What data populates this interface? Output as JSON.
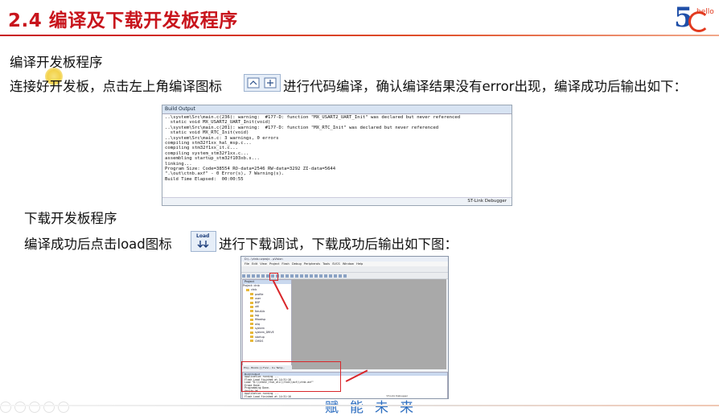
{
  "slide": {
    "title": "2.4 编译及下载开发板程序",
    "logo_text": "hello",
    "logo_digit": "5",
    "section1_heading": "编译开发板程序",
    "section1_text_a": "连接好开发板，点击左上角编译图标",
    "section1_text_b": "进行代码编译，确认编译结果没有error出现，编译成功后输出如下：",
    "section2_heading": "下载开发板程序",
    "section2_text_a": "编译成功后点击load图标",
    "section2_text_b": "进行下载调试，下载成功后输出如下图：",
    "load_icon_text": "Load",
    "bottom_text": "赋能未来"
  },
  "build_output": {
    "header": "Build Output",
    "lines": [
      "..\\system\\Src\\main.c(236): warning:  #177-D: function \"MX_USART2_UART_Init\" was declared but never referenced",
      "  static void MX_USART2_UART_Init(void)",
      "..\\system\\Src\\main.c(201): warning:  #177-D: function \"MX_RTC_Init\" was declared but never referenced",
      "  static void MX_RTC_Init(void)",
      "..\\system\\Src\\main.c: 3 warnings, 0 errors",
      "compiling stm32f1xx_hal_msp.c...",
      "compiling stm32f1xx_it.c...",
      "compiling system_stm32f1xx.c...",
      "assembling startup_stm32f103xb.s...",
      "linking...",
      "Program Size: Code=38554 RO-data=2546 RW-data=3292 ZI-data=5644",
      "\".\\out\\ctnb.axf\" - 0 Error(s), 7 Warning(s).",
      "Build Time Elapsed:  00:00:55"
    ],
    "status": "ST-Link Debugger"
  },
  "ide": {
    "title_text": "D:\\...\\ctnb.uvprojx - µVision",
    "menu": [
      "File",
      "Edit",
      "View",
      "Project",
      "Flash",
      "Debug",
      "Peripherals",
      "Tools",
      "SVCS",
      "Window",
      "Help"
    ],
    "project_header": "Project",
    "project_root": "Project: ctnb",
    "tree_items": [
      "ctnb",
      "profile",
      "user",
      "BSP",
      "util",
      "NeulLib",
      "log",
      "fifoadsp",
      "aliq",
      "system",
      "system_DRIVE",
      "startup",
      "CMSIS"
    ],
    "panel_tabs": "Proj... Books {} Func... 0+ Temp...",
    "build_header": "Build Output",
    "output_lines": [
      "Application running ...",
      "Flash Load finished at 14:31:16",
      "Load \"D:\\\\stm32_rtuk_ali\\\\rtuk\\\\out\\\\ctnb.axf\"",
      "Erase Done.",
      "Programming Done.",
      "Verify OK.",
      "Application running ...",
      "Flash Load finished at 14:31:16"
    ],
    "status": "ST-Link Debugger"
  }
}
